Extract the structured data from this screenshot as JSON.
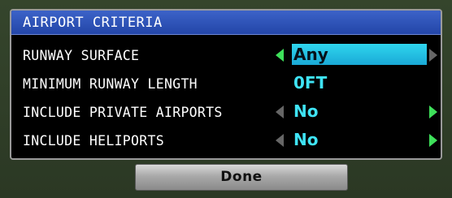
{
  "panel": {
    "title": "AIRPORT CRITERIA"
  },
  "rows": [
    {
      "label": "RUNWAY SURFACE",
      "value": "Any",
      "left_arrow_active": true,
      "right_arrow_active": false,
      "selected": true
    },
    {
      "label": "MINIMUM RUNWAY LENGTH",
      "value": "0FT",
      "left_arrow_active": false,
      "right_arrow_active": false,
      "selected": false
    },
    {
      "label": "INCLUDE PRIVATE AIRPORTS",
      "value": "No",
      "left_arrow_active": false,
      "right_arrow_active": true,
      "selected": false
    },
    {
      "label": "INCLUDE HELIPORTS",
      "value": "No",
      "left_arrow_active": false,
      "right_arrow_active": true,
      "selected": false
    }
  ],
  "done_button": {
    "label": "Done"
  },
  "colors": {
    "title_bar": "#2d52b8",
    "value_text": "#3fe4f6",
    "selection_highlight": "#22c1e3",
    "active_arrow": "#3ee05a",
    "inactive_arrow": "#666666"
  },
  "icons": {
    "left": "triangle-left-icon",
    "right": "triangle-right-icon"
  }
}
